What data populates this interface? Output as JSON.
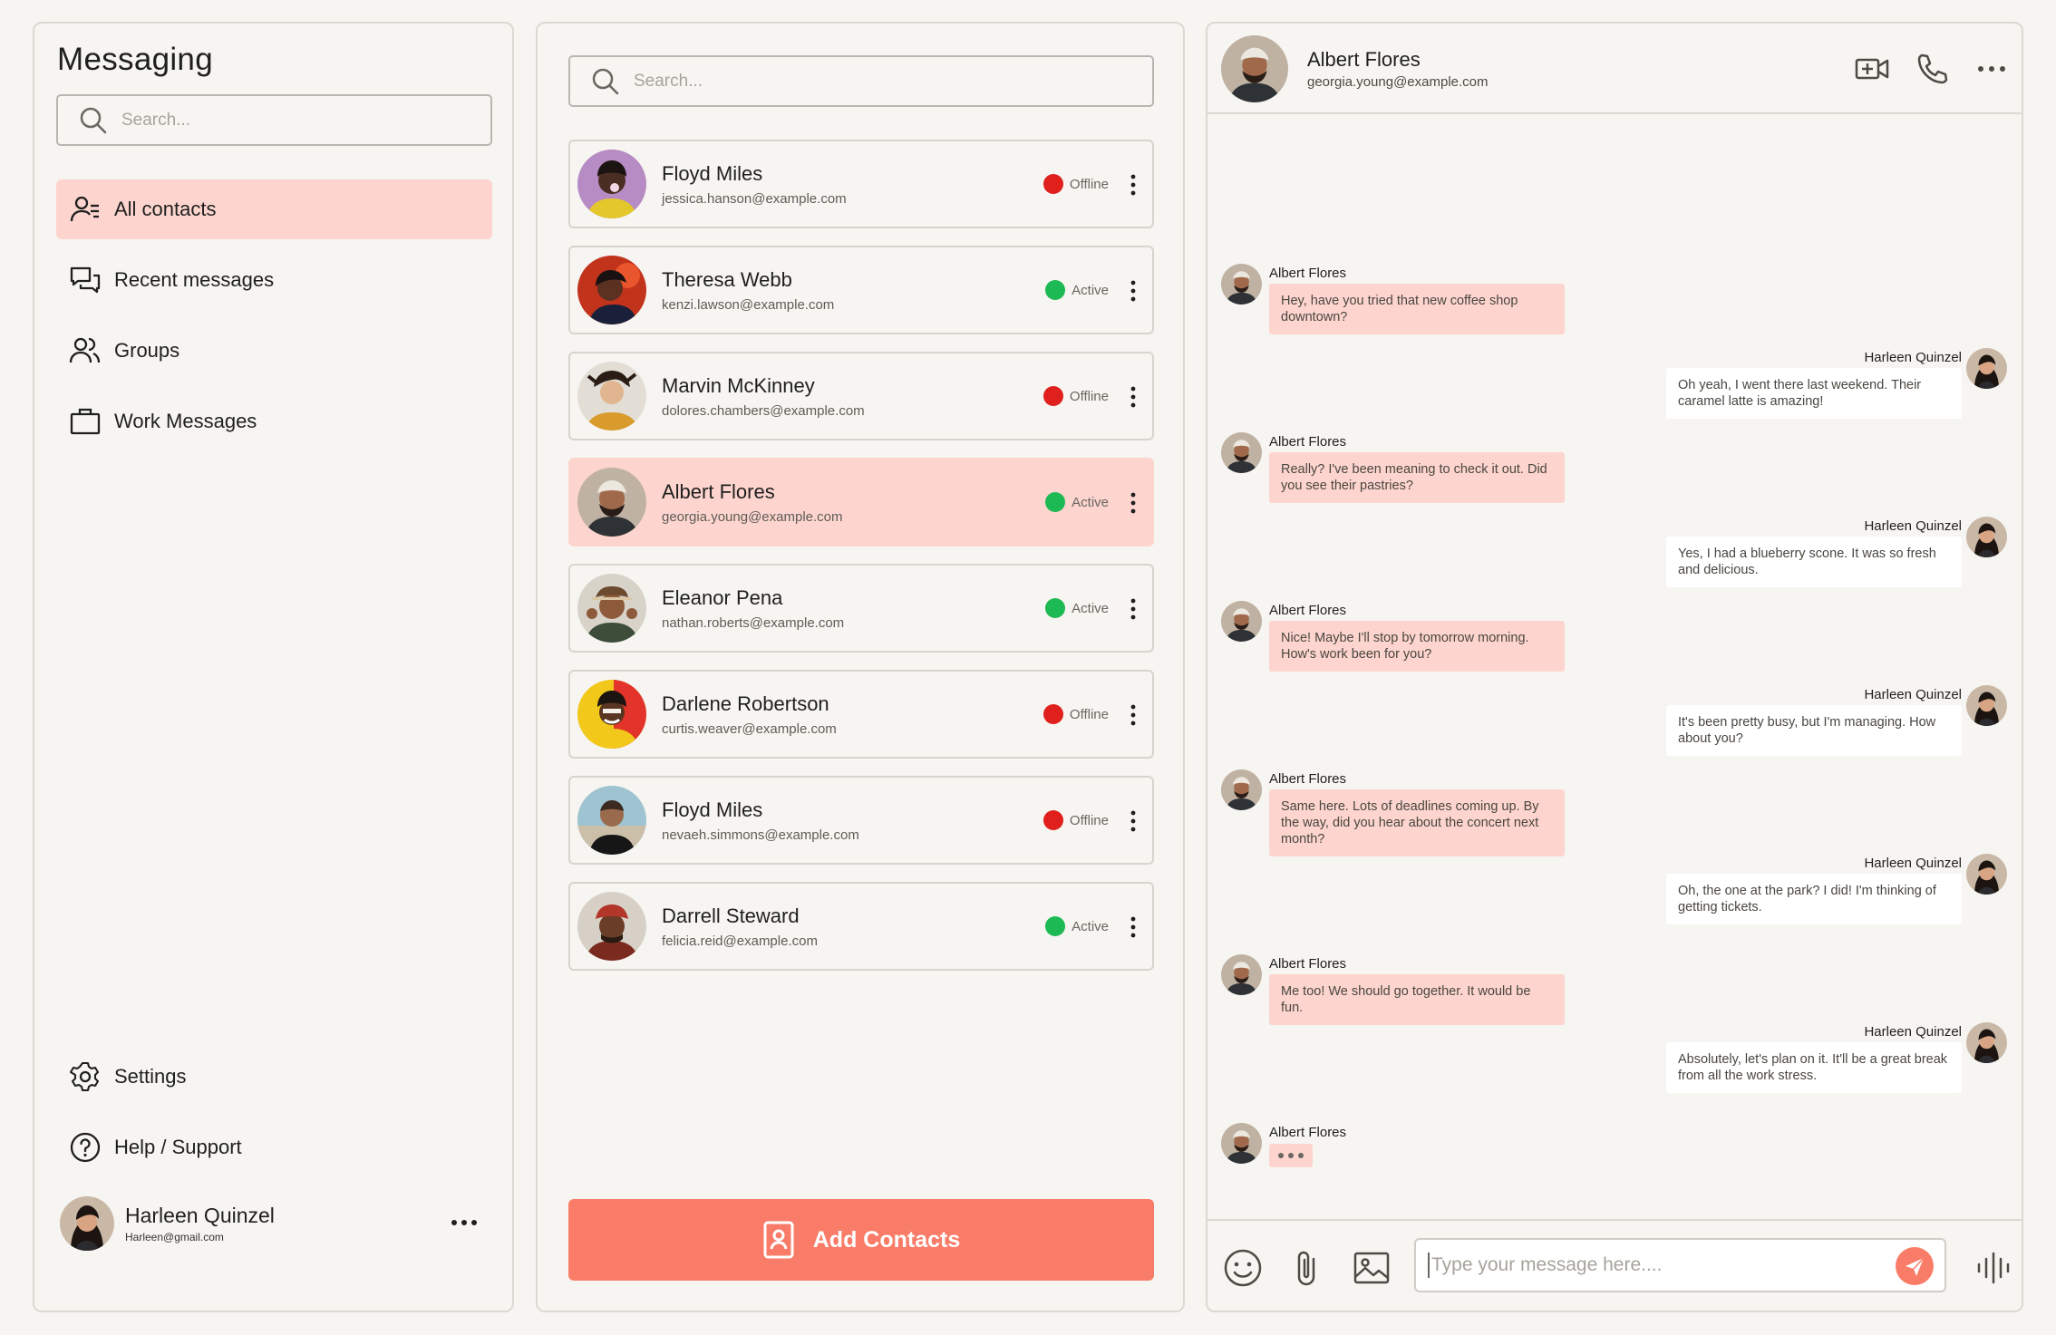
{
  "app": {
    "title": "Messaging"
  },
  "sidebar": {
    "search_placeholder": "Search...",
    "nav": [
      {
        "label": "All contacts",
        "icon": "contacts-icon"
      },
      {
        "label": "Recent messages",
        "icon": "chat-bubbles-icon"
      },
      {
        "label": "Groups",
        "icon": "group-icon"
      },
      {
        "label": "Work Messages",
        "icon": "briefcase-icon"
      }
    ],
    "footer": [
      {
        "label": "Settings",
        "icon": "gear-icon"
      },
      {
        "label": "Help / Support",
        "icon": "help-icon"
      }
    ],
    "user": {
      "name": "Harleen Quinzel",
      "email": "Harleen@gmail.com"
    }
  },
  "contacts": {
    "search_placeholder": "Search...",
    "items": [
      {
        "name": "Floyd Miles",
        "email": "jessica.hanson@example.com",
        "status": "Offline"
      },
      {
        "name": "Theresa Webb",
        "email": "kenzi.lawson@example.com",
        "status": "Active"
      },
      {
        "name": "Marvin McKinney",
        "email": "dolores.chambers@example.com",
        "status": "Offline"
      },
      {
        "name": "Albert Flores",
        "email": "georgia.young@example.com",
        "status": "Active"
      },
      {
        "name": "Eleanor Pena",
        "email": "nathan.roberts@example.com",
        "status": "Active"
      },
      {
        "name": "Darlene Robertson",
        "email": "curtis.weaver@example.com",
        "status": "Offline"
      },
      {
        "name": "Floyd Miles",
        "email": "nevaeh.simmons@example.com",
        "status": "Offline"
      },
      {
        "name": "Darrell Steward",
        "email": "felicia.reid@example.com",
        "status": "Active"
      }
    ],
    "add_button_label": "Add Contacts"
  },
  "chat": {
    "header": {
      "name": "Albert Flores",
      "email": "georgia.young@example.com"
    },
    "messages": [
      {
        "from": "Albert Flores",
        "text": "Hey, have you tried that new coffee shop downtown?"
      },
      {
        "from": "Harleen Quinzel",
        "text": "Oh yeah, I went there last weekend. Their caramel latte is amazing!"
      },
      {
        "from": "Albert Flores",
        "text": "Really? I've been meaning to check it out. Did you see their pastries?"
      },
      {
        "from": "Harleen Quinzel",
        "text": "Yes, I had a blueberry scone. It was so fresh and delicious."
      },
      {
        "from": "Albert Flores",
        "text": "Nice! Maybe I'll stop by tomorrow morning. How's work been for you?"
      },
      {
        "from": "Harleen Quinzel",
        "text": "It's been pretty busy, but I'm managing. How about you?"
      },
      {
        "from": "Albert Flores",
        "text": "Same here. Lots of deadlines coming up. By the way, did you hear about the concert next month?"
      },
      {
        "from": "Harleen Quinzel",
        "text": "Oh, the one at the park? I did! I'm thinking of getting tickets."
      },
      {
        "from": "Albert Flores",
        "text": "Me too! We should go together. It would be fun."
      },
      {
        "from": "Harleen Quinzel",
        "text": "Absolutely, let's plan on it. It'll be a great break from all the work stress."
      }
    ],
    "typing_from": "Albert Flores",
    "composer_placeholder": "Type your message here...."
  },
  "colors": {
    "accent": "#f97c68",
    "selected_bg": "#fdd5ce",
    "active": "#1db954",
    "offline": "#e0201c",
    "background": "#f7f5f1"
  }
}
